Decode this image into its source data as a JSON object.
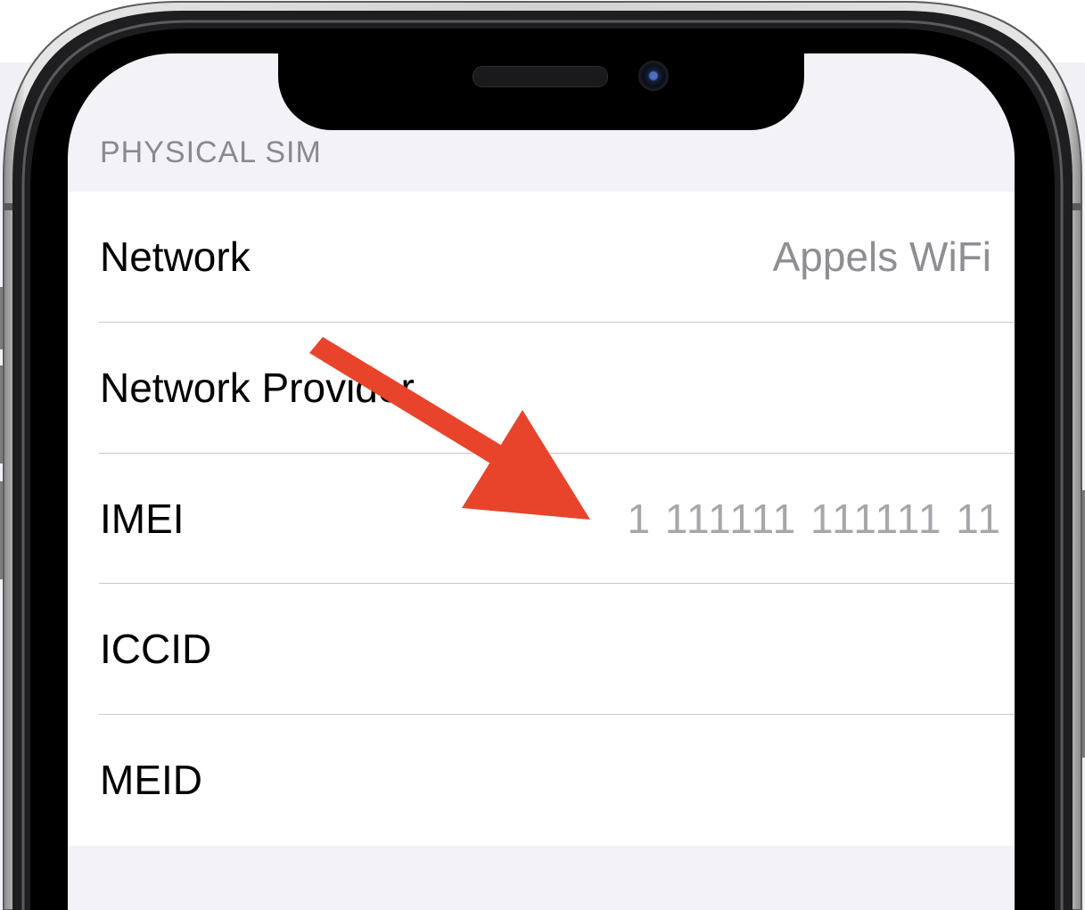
{
  "section": {
    "header": "PHYSICAL SIM"
  },
  "rows": [
    {
      "label": "Network",
      "value": "Appels WiFi"
    },
    {
      "label": "Network Provider",
      "value": ""
    },
    {
      "label": "IMEI",
      "value": "1 111111 111111 11"
    },
    {
      "label": "ICCID",
      "value": ""
    },
    {
      "label": "MEID",
      "value": ""
    }
  ],
  "colors": {
    "annotation_arrow": "#e8442b",
    "grouped_background": "#f2f2f7",
    "secondary_label": "#8e8e93",
    "separator": "#c9c9ce"
  },
  "icons": {
    "annotation": "arrow-pointer-icon",
    "front_camera": "camera-icon",
    "earpiece": "speaker-icon"
  }
}
